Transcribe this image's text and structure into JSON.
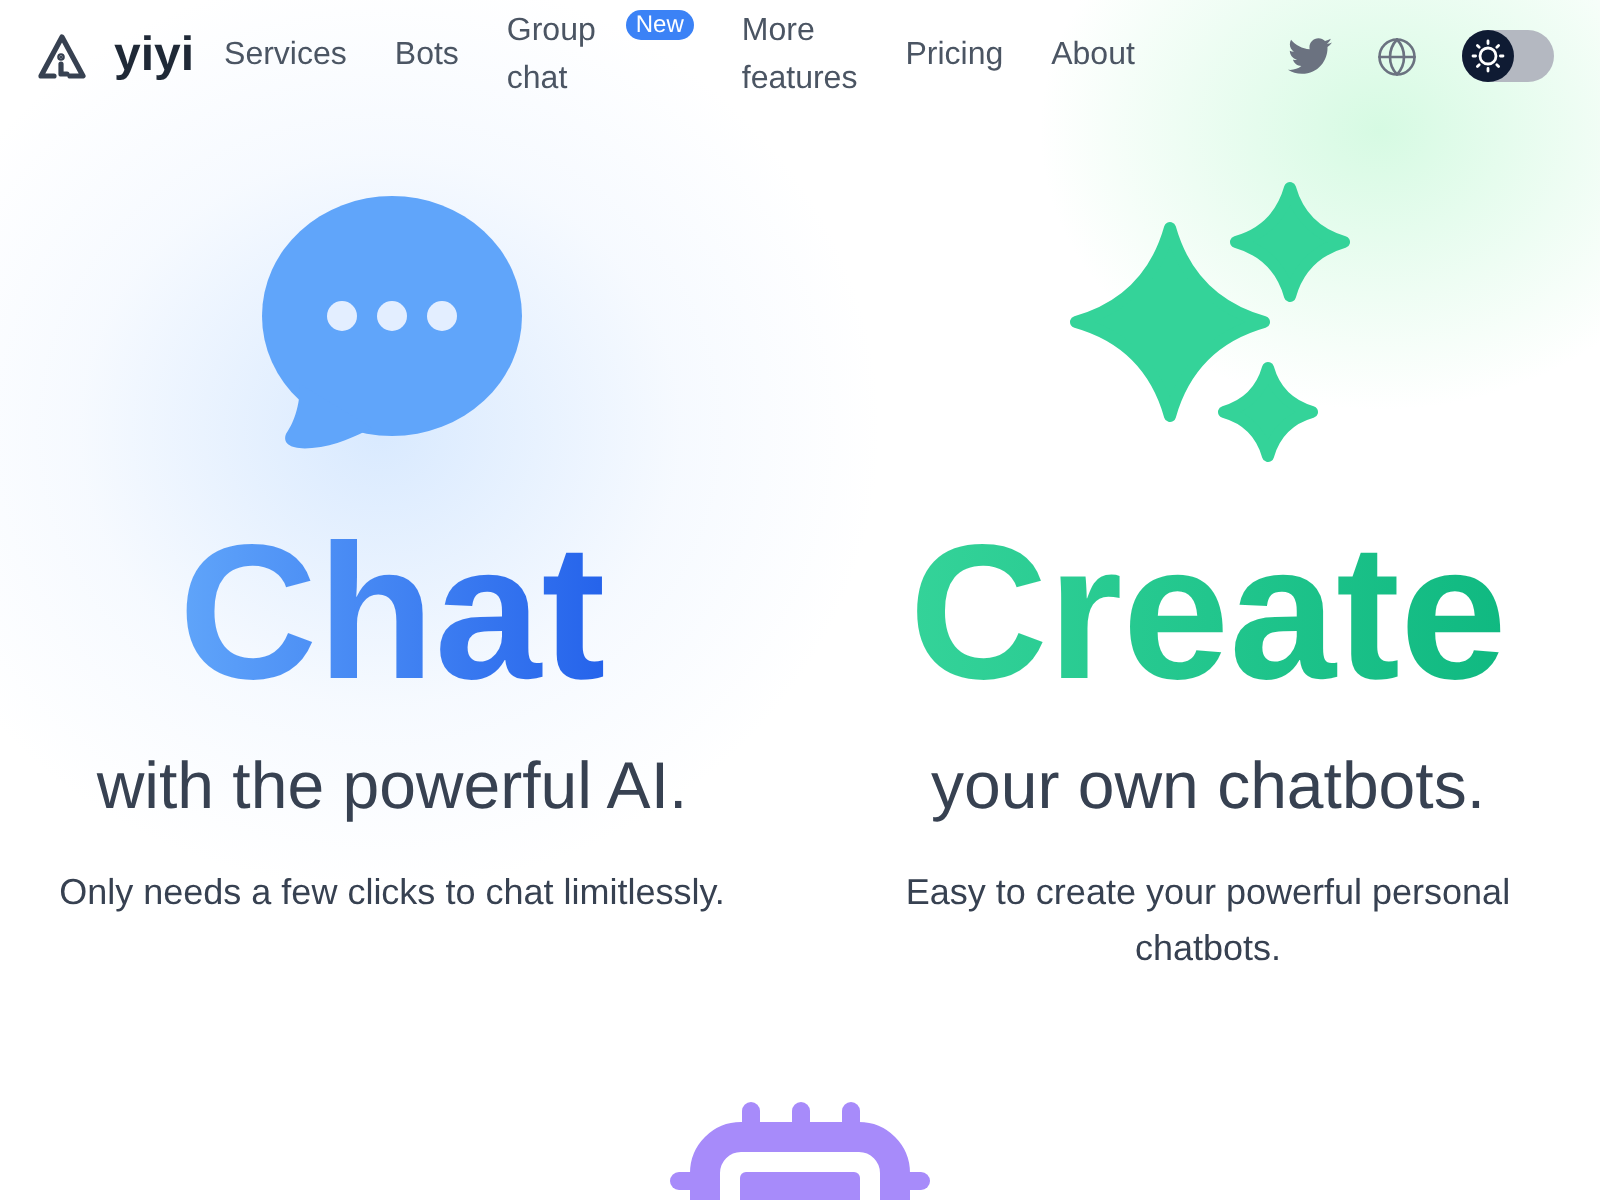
{
  "nav": {
    "logo": "yiyi",
    "links": [
      {
        "label": "Services"
      },
      {
        "label": "Bots"
      },
      {
        "label": "Group chat",
        "badge": "New"
      },
      {
        "label": "More features"
      },
      {
        "label": "Pricing"
      },
      {
        "label": "About"
      }
    ],
    "theme_toggle": {
      "on": false
    }
  },
  "features": [
    {
      "kind": "chat",
      "title": "Chat",
      "subtitle": "with the powerful AI.",
      "description": "Only needs a few clicks to chat limitlessly."
    },
    {
      "kind": "create",
      "title": "Create",
      "subtitle": "your own chatbots.",
      "description": "Easy to create your powerful personal chatbots."
    },
    {
      "kind": "chip"
    }
  ]
}
